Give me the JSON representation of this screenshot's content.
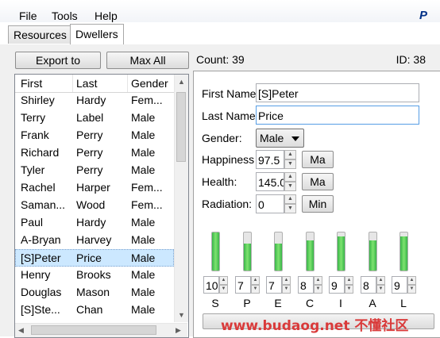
{
  "menu": [
    "File",
    "Tools",
    "Help"
  ],
  "tabs": [
    "Resources",
    "Dwellers"
  ],
  "toolbar": {
    "export_label": "Export to",
    "max_all_label": "Max All"
  },
  "status": {
    "count": "Count: 39",
    "id": "ID: 38"
  },
  "list": {
    "headers": [
      "First",
      "Last",
      "Gender"
    ],
    "rows": [
      {
        "first": "Shirley",
        "last": "Hardy",
        "gender": "Fem..."
      },
      {
        "first": "Terry",
        "last": "Label",
        "gender": "Male"
      },
      {
        "first": "Frank",
        "last": "Perry",
        "gender": "Male"
      },
      {
        "first": "Richard",
        "last": "Perry",
        "gender": "Male"
      },
      {
        "first": "Tyler",
        "last": "Perry",
        "gender": "Male"
      },
      {
        "first": "Rachel",
        "last": "Harper",
        "gender": "Fem..."
      },
      {
        "first": "Saman...",
        "last": "Wood",
        "gender": "Fem..."
      },
      {
        "first": "Paul",
        "last": "Hardy",
        "gender": "Male"
      },
      {
        "first": "A-Bryan",
        "last": "Harvey",
        "gender": "Male"
      },
      {
        "first": "[S]Peter",
        "last": "Price",
        "gender": "Male",
        "selected": true
      },
      {
        "first": "Henry",
        "last": "Brooks",
        "gender": "Male"
      },
      {
        "first": "Douglas",
        "last": "Mason",
        "gender": "Male"
      },
      {
        "first": "[S]Ste...",
        "last": "Chan",
        "gender": "Male"
      }
    ]
  },
  "detail": {
    "first_name_label": "First Name",
    "first_name_value": "[S]Peter",
    "last_name_label": "Last Name",
    "last_name_value": "Price",
    "gender_label": "Gender:",
    "gender_value": "Male",
    "happiness_label": "Happiness",
    "happiness_value": "97.5",
    "happiness_button": "Ma",
    "health_label": "Health:",
    "health_value": "145.0",
    "health_button": "Ma",
    "radiation_label": "Radiation:",
    "radiation_value": "0",
    "radiation_button": "Min"
  },
  "special": [
    {
      "letter": "S",
      "value": "10",
      "level": 1.0
    },
    {
      "letter": "P",
      "value": "7",
      "level": 0.7
    },
    {
      "letter": "E",
      "value": "7",
      "level": 0.7
    },
    {
      "letter": "C",
      "value": "8",
      "level": 0.8
    },
    {
      "letter": "I",
      "value": "9",
      "level": 0.9
    },
    {
      "letter": "A",
      "value": "8",
      "level": 0.8
    },
    {
      "letter": "L",
      "value": "9",
      "level": 0.9
    }
  ],
  "watermark": "www.budaog.net 不懂社区",
  "colors": {
    "gauge_green": "#39b54a",
    "selection": "#cce8ff",
    "focus_border": "#569de5"
  },
  "icons": {
    "brand": "paypal-icon"
  }
}
